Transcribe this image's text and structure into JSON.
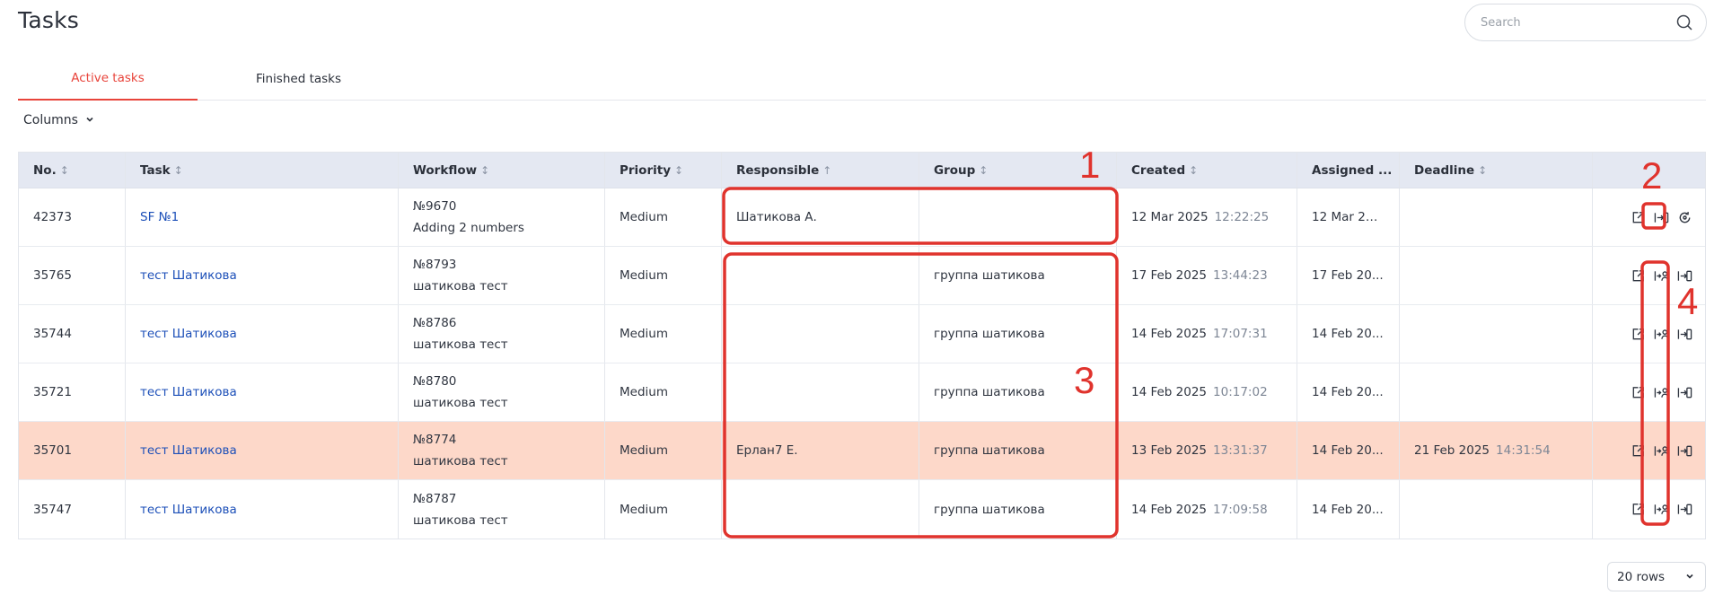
{
  "page": {
    "title": "Tasks"
  },
  "search": {
    "placeholder": "Search",
    "value": "",
    "icon": "search-icon"
  },
  "tabs": [
    {
      "label": "Active tasks",
      "active": true
    },
    {
      "label": "Finished tasks",
      "active": false
    }
  ],
  "columns_button": {
    "label": "Columns"
  },
  "table": {
    "headers": [
      {
        "label": "No.",
        "sort": "↕"
      },
      {
        "label": "Task",
        "sort": "↕"
      },
      {
        "label": "Workflow",
        "sort": "↕"
      },
      {
        "label": "Priority",
        "sort": "↕"
      },
      {
        "label": "Responsible",
        "sort": "↑"
      },
      {
        "label": "Group",
        "sort": "↕"
      },
      {
        "label": "Created",
        "sort": "↕"
      },
      {
        "label": "Assigned ...",
        "sort": ""
      },
      {
        "label": "Deadline",
        "sort": "↕"
      },
      {
        "label": "",
        "sort": ""
      }
    ],
    "rows": [
      {
        "no": "42373",
        "task": "SF №1",
        "wf_no": "№9670",
        "wf_name": "Adding 2 numbers",
        "priority": "Medium",
        "responsible": "Шатикова А.",
        "group": "",
        "created_date": "12 Mar 2025",
        "created_time": "12:22:25",
        "assigned": "12 Mar 20...",
        "deadline_date": "",
        "deadline_time": "",
        "highlight": false,
        "actions": [
          "open-external-icon",
          "take-task-icon",
          "refresh-icon"
        ]
      },
      {
        "no": "35765",
        "task": "тест Шатикова",
        "wf_no": "№8793",
        "wf_name": "шатикова тест",
        "priority": "Medium",
        "responsible": "",
        "group": "группа шатикова",
        "created_date": "17 Feb 2025",
        "created_time": "13:44:23",
        "assigned": "17 Feb 20...",
        "deadline_date": "",
        "deadline_time": "",
        "highlight": false,
        "actions": [
          "open-external-icon",
          "assign-user-icon",
          "take-task-icon"
        ]
      },
      {
        "no": "35744",
        "task": "тест Шатикова",
        "wf_no": "№8786",
        "wf_name": "шатикова тест",
        "priority": "Medium",
        "responsible": "",
        "group": "группа шатикова",
        "created_date": "14 Feb 2025",
        "created_time": "17:07:31",
        "assigned": "14 Feb 20...",
        "deadline_date": "",
        "deadline_time": "",
        "highlight": false,
        "actions": [
          "open-external-icon",
          "assign-user-icon",
          "take-task-icon"
        ]
      },
      {
        "no": "35721",
        "task": "тест Шатикова",
        "wf_no": "№8780",
        "wf_name": "шатикова тест",
        "priority": "Medium",
        "responsible": "",
        "group": "группа шатикова",
        "created_date": "14 Feb 2025",
        "created_time": "10:17:02",
        "assigned": "14 Feb 20...",
        "deadline_date": "",
        "deadline_time": "",
        "highlight": false,
        "actions": [
          "open-external-icon",
          "assign-user-icon",
          "take-task-icon"
        ]
      },
      {
        "no": "35701",
        "task": "тест Шатикова",
        "wf_no": "№8774",
        "wf_name": "шатикова тест",
        "priority": "Medium",
        "responsible": "Ерлан7 Е.",
        "group": "группа шатикова",
        "created_date": "13 Feb 2025",
        "created_time": "13:31:37",
        "assigned": "14 Feb 20...",
        "deadline_date": "21 Feb 2025",
        "deadline_time": "14:31:54",
        "highlight": true,
        "actions": [
          "open-external-icon",
          "assign-user-icon",
          "take-task-icon"
        ]
      },
      {
        "no": "35747",
        "task": "тест Шатикова",
        "wf_no": "№8787",
        "wf_name": "шатикова тест",
        "priority": "Medium",
        "responsible": "",
        "group": "группа шатикова",
        "created_date": "14 Feb 2025",
        "created_time": "17:09:58",
        "assigned": "14 Feb 20...",
        "deadline_date": "",
        "deadline_time": "",
        "highlight": false,
        "actions": [
          "open-external-icon",
          "assign-user-icon",
          "take-task-icon"
        ]
      }
    ]
  },
  "pagination": {
    "rows_label": "20 rows"
  },
  "annotations": {
    "color": "#e0332d",
    "labels": [
      "1",
      "2",
      "3",
      "4"
    ]
  },
  "colors": {
    "accent": "#e8443b",
    "link": "#1c4fb8",
    "header_bg": "#e4e8f2",
    "highlight_row": "#fdd8c9"
  }
}
